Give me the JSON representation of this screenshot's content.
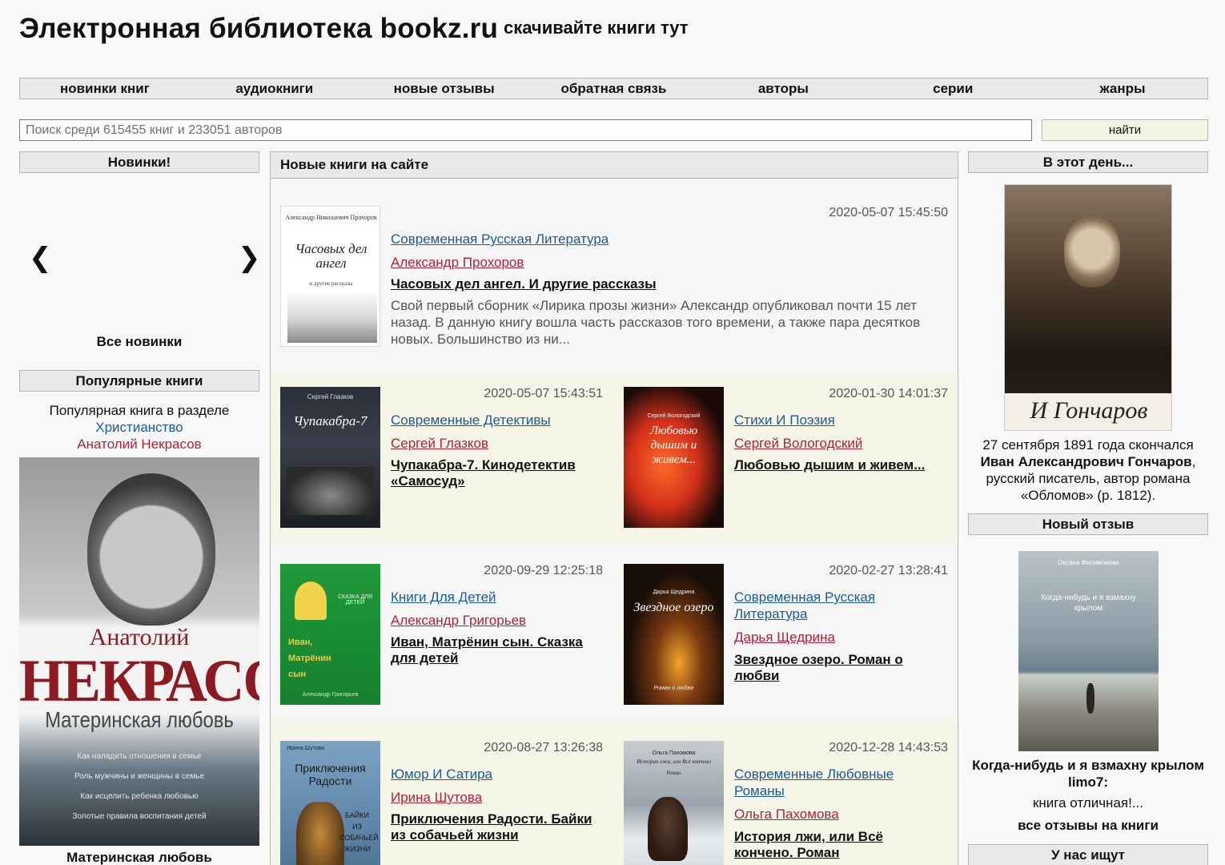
{
  "header": {
    "title": "Электронная библиотека bookz.ru",
    "tagline": "скачивайте книги тут"
  },
  "nav": {
    "items": [
      "новинки книг",
      "аудиокниги",
      "новые отзывы",
      "обратная связь",
      "авторы",
      "серии",
      "жанры"
    ]
  },
  "search": {
    "placeholder": "Поиск среди 615455 книг и 233051 авторов",
    "value": "",
    "button": "найти"
  },
  "left": {
    "new_head": "Новинки!",
    "prev_arrow": "❮",
    "next_arrow": "❯",
    "all_new": "Все новинки",
    "popular_head": "Популярные книги",
    "popular_intro": "Популярная книга в разделе",
    "popular_section": "Христианство",
    "popular_author": "Анатолий Некрасов",
    "cover": {
      "first_name": "Анатолий",
      "last_name": "НЕКРАСОВ",
      "title": "Материнская любовь",
      "lines": [
        "Как наладить отношения в семье",
        "Роль мужчины и женщины в семье",
        "Как исцелить ребенка любовью",
        "Золотые правила воспитания детей"
      ]
    },
    "popular_caption": "Материнская любовь"
  },
  "center": {
    "head": "Новые книги на сайте",
    "books": [
      {
        "date": "2020-05-07 15:45:50",
        "genre": "Современная Русская Литература",
        "author": "Александр Прохоров",
        "title": "Часовых дел ангел. И другие рассказы",
        "desc": "Свой первый сборник «Лирика прозы жизни» Александр опубликовал почти 15 лет назад. В данную книгу вошла часть рассказов того времени, а также пара десятков новых. Большинство из ни...",
        "cover_author": "Александр Николаевич Прохоров",
        "cover_title": "Часовых дел ангел",
        "cover_sub": "и другие рассказы"
      },
      {
        "date": "2020-05-07 15:43:51",
        "genre": "Современные Детективы",
        "author": "Сергей Глазков",
        "title": "Чупакабра-7. Кинодетектив «Самосуд»",
        "cover_author": "Сергей Глазков",
        "cover_title": "Чупакабра-7"
      },
      {
        "date": "2020-01-30 14:01:37",
        "genre": "Стихи И Поэзия",
        "author": "Сергей Вологодский",
        "title": "Любовью дышим и живем...",
        "cover_author": "Сергей Вологодский",
        "cover_title": "Любовью дышим и живем..."
      },
      {
        "date": "2020-09-29 12:25:18",
        "genre": "Книги Для Детей",
        "author": "Александр Григорьев",
        "title": "Иван, Матрёнин сын. Сказка для детей",
        "cover_title": "Иван, Матрёнин сын",
        "cover_sub": "СКАЗКА ДЛЯ ДЕТЕЙ",
        "cover_author": "Александр Григорьев"
      },
      {
        "date": "2020-02-27 13:28:41",
        "genre": "Современная Русская Литература",
        "author": "Дарья Щедрина",
        "title": "Звездное озеро. Роман о любви",
        "cover_author": "Дарья Щедрина",
        "cover_title": "Звездное озеро",
        "cover_sub": "Роман о любви"
      },
      {
        "date": "2020-08-27 13:26:38",
        "genre": "Юмор И Сатира",
        "author": "Ирина Шутова",
        "title": "Приключения Радости. Байки из собачьей жизни",
        "cover_author": "Ирина Шутова",
        "cover_title": "Приключения Радости",
        "cover_sub": "БАЙКИ ИЗ СОБАЧЬЕЙ ЖИЗНИ"
      },
      {
        "date": "2020-12-28 14:43:53",
        "genre": "Современные Любовные Романы",
        "author": "Ольга Пахомова",
        "title": "История лжи, или Всё кончено. Роман",
        "cover_author": "Ольга Пахомова",
        "cover_title": "История лжи, или Всё кончено",
        "cover_sub": "Роман"
      }
    ]
  },
  "right": {
    "day_head": "В этот день...",
    "signature": "И Гончаров",
    "day_intro": "27 сентября 1891 года скончался",
    "day_name": "Иван Александрович Гончаров",
    "day_rest": "русский писатель, автор романа «Обломов» (р. 1812).",
    "review_head": "Новый отзыв",
    "review_cover_author": "Оксана Филимонова",
    "review_cover_title": "Когда-нибудь и я взмахну крылом",
    "review_title": "Когда-нибудь и я взмахну крылом",
    "review_user": "limo7:",
    "review_text": "книга отличная!...",
    "review_all": "все отзывы на книги",
    "search_head": "У нас ищут"
  }
}
